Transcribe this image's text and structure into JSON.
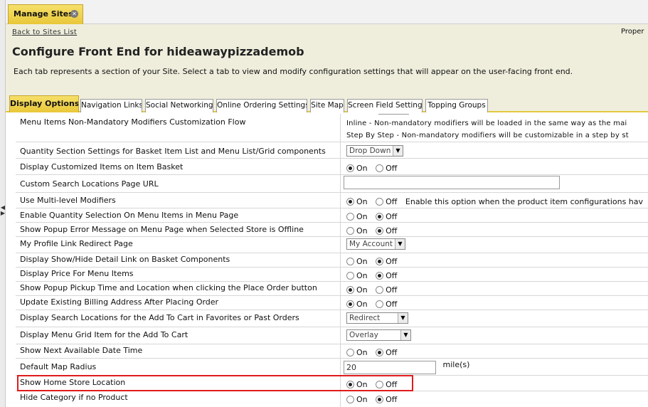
{
  "top_tab": {
    "label": "Manage Sites",
    "close_icon": "close-circle-icon"
  },
  "header": {
    "back_link": "Back to Sites List",
    "right_text": "Proper",
    "title": "Configure Front End for hideawaypizzademob",
    "description": "Each tab represents a section of your Site. Select a tab to view and modify configuration settings that will appear on the user-facing front end."
  },
  "tabs": [
    {
      "label": "Display Options",
      "active": true
    },
    {
      "label": "Navigation Links",
      "active": false
    },
    {
      "label": "Social Networking",
      "active": false
    },
    {
      "label": "Online Ordering Settings",
      "active": false
    },
    {
      "label": "Site Map",
      "active": false
    },
    {
      "label": "Screen Field Setting",
      "active": false
    },
    {
      "label": "Topping Groups",
      "active": false
    }
  ],
  "radio": {
    "on": "On",
    "off": "Off"
  },
  "settings": [
    {
      "label": "Menu Items Non-Mandatory Modifiers Customization Flow",
      "desc1": "Inline - Non-mandatory modifiers will be loaded in the same way as the mai",
      "desc2": "Step By Step - Non-mandatory modifiers will be customizable in a step by st"
    },
    {
      "label": "Quantity Section Settings for Basket Item List and Menu List/Grid components",
      "value": "Drop Down"
    },
    {
      "label": "Display Customized Items on Item Basket",
      "value": "On"
    },
    {
      "label": "Custom Search Locations Page URL",
      "value": ""
    },
    {
      "label": "Use Multi-level Modifiers",
      "value": "On",
      "note": "Enable this option when the product item configurations hav"
    },
    {
      "label": "Enable Quantity Selection On Menu Items in Menu Page",
      "value": "Off"
    },
    {
      "label": "Show Popup Error Message on Menu Page when Selected Store is Offline",
      "value": "Off"
    },
    {
      "label": "My Profile Link Redirect Page",
      "value": "My Account"
    },
    {
      "label": "Display Show/Hide Detail Link on Basket Components",
      "value": "Off"
    },
    {
      "label": "Display Price For Menu Items",
      "value": "Off"
    },
    {
      "label": "Show Popup Pickup Time and Location when clicking the Place Order button",
      "value": "On"
    },
    {
      "label": "Update Existing Billing Address After Placing Order",
      "value": "On"
    },
    {
      "label": "Display Search Locations for the Add To Cart in Favorites or Past Orders",
      "value": "Redirect"
    },
    {
      "label": "Display Menu Grid Item for the Add To Cart",
      "value": "Overlay"
    },
    {
      "label": "Show Next Available Date Time",
      "value": "Off"
    },
    {
      "label": "Default Map Radius",
      "value": "20",
      "unit": "mile(s)"
    },
    {
      "label": "Show Home Store Location",
      "value": "On"
    },
    {
      "label": "Hide Category if no Product",
      "value": "Off"
    }
  ]
}
